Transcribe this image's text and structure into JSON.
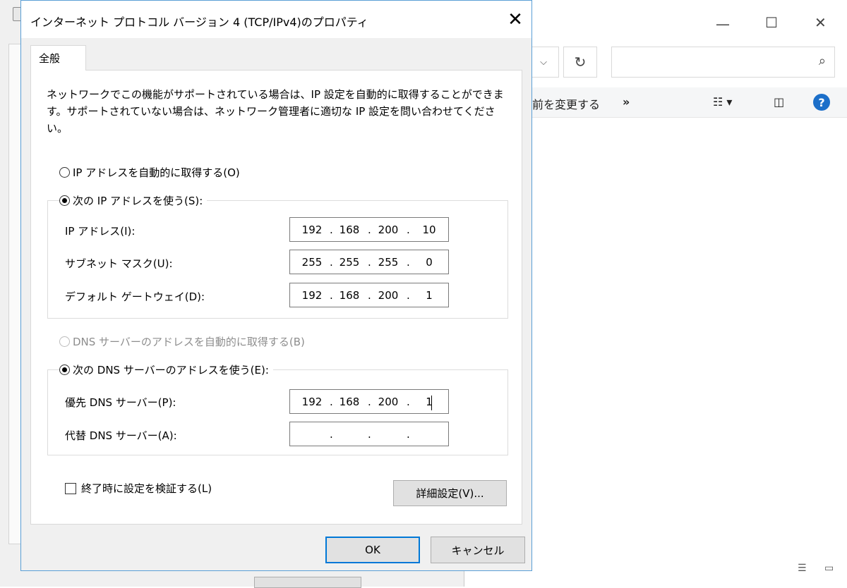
{
  "explorer": {
    "nav_dropdown_icon": "chevron-down-icon",
    "refresh_icon": "refresh-icon",
    "search_icon": "search-icon",
    "toolbar_text": "前を変更する",
    "overflow": "»",
    "help": "?"
  },
  "dialog": {
    "title": "インターネット プロトコル バージョン 4 (TCP/IPv4)のプロパティ",
    "close": "✕",
    "tab_label": "全般",
    "description": "ネットワークでこの機能がサポートされている場合は、IP 設定を自動的に取得することができます。サポートされていない場合は、ネットワーク管理者に適切な IP 設定を問い合わせてください。",
    "ip_auto_label": "IP アドレスを自動的に取得する(O)",
    "ip_manual_label": "次の IP アドレスを使う(S):",
    "ip_address": {
      "label": "IP アドレス(I):",
      "octets": [
        "192",
        "168",
        "200",
        "10"
      ]
    },
    "subnet_mask": {
      "label": "サブネット マスク(U):",
      "octets": [
        "255",
        "255",
        "255",
        "0"
      ]
    },
    "gateway": {
      "label": "デフォルト ゲートウェイ(D):",
      "octets": [
        "192",
        "168",
        "200",
        "1"
      ]
    },
    "dns_auto_label": "DNS サーバーのアドレスを自動的に取得する(B)",
    "dns_manual_label": "次の DNS サーバーのアドレスを使う(E):",
    "preferred_dns": {
      "label": "優先 DNS サーバー(P):",
      "octets": [
        "192",
        "168",
        "200",
        "1"
      ]
    },
    "alternate_dns": {
      "label": "代替 DNS サーバー(A):",
      "octets": [
        "",
        "",
        "",
        ""
      ]
    },
    "validate_label": "終了時に設定を検証する(L)",
    "advanced_button": "詳細設定(V)...",
    "ok_button": "OK",
    "cancel_button": "キャンセル"
  }
}
